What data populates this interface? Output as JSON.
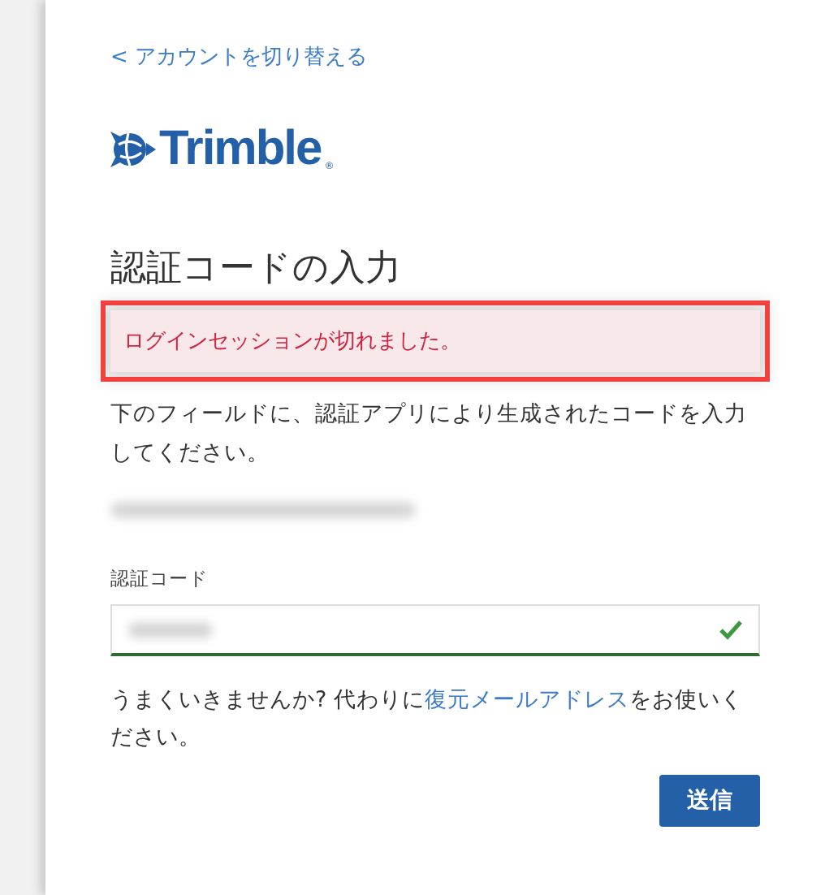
{
  "back_link": {
    "label": "< アカウントを切り替える"
  },
  "logo": {
    "text": "Trimble",
    "mark": "®"
  },
  "heading": "認証コードの入力",
  "alert": {
    "message": "ログインセッションが切れました。",
    "highlighted": true
  },
  "instructions": "下のフィールドに、認証アプリにより生成されたコードを入力してください。",
  "account": {
    "redacted": true
  },
  "code_field": {
    "label": "認証コード",
    "value_redacted": true,
    "valid": true
  },
  "help": {
    "before": "うまくいきませんか? 代わりに",
    "link": "復元メールアドレス",
    "after": "をお使いください。"
  },
  "submit_button": "送信"
}
